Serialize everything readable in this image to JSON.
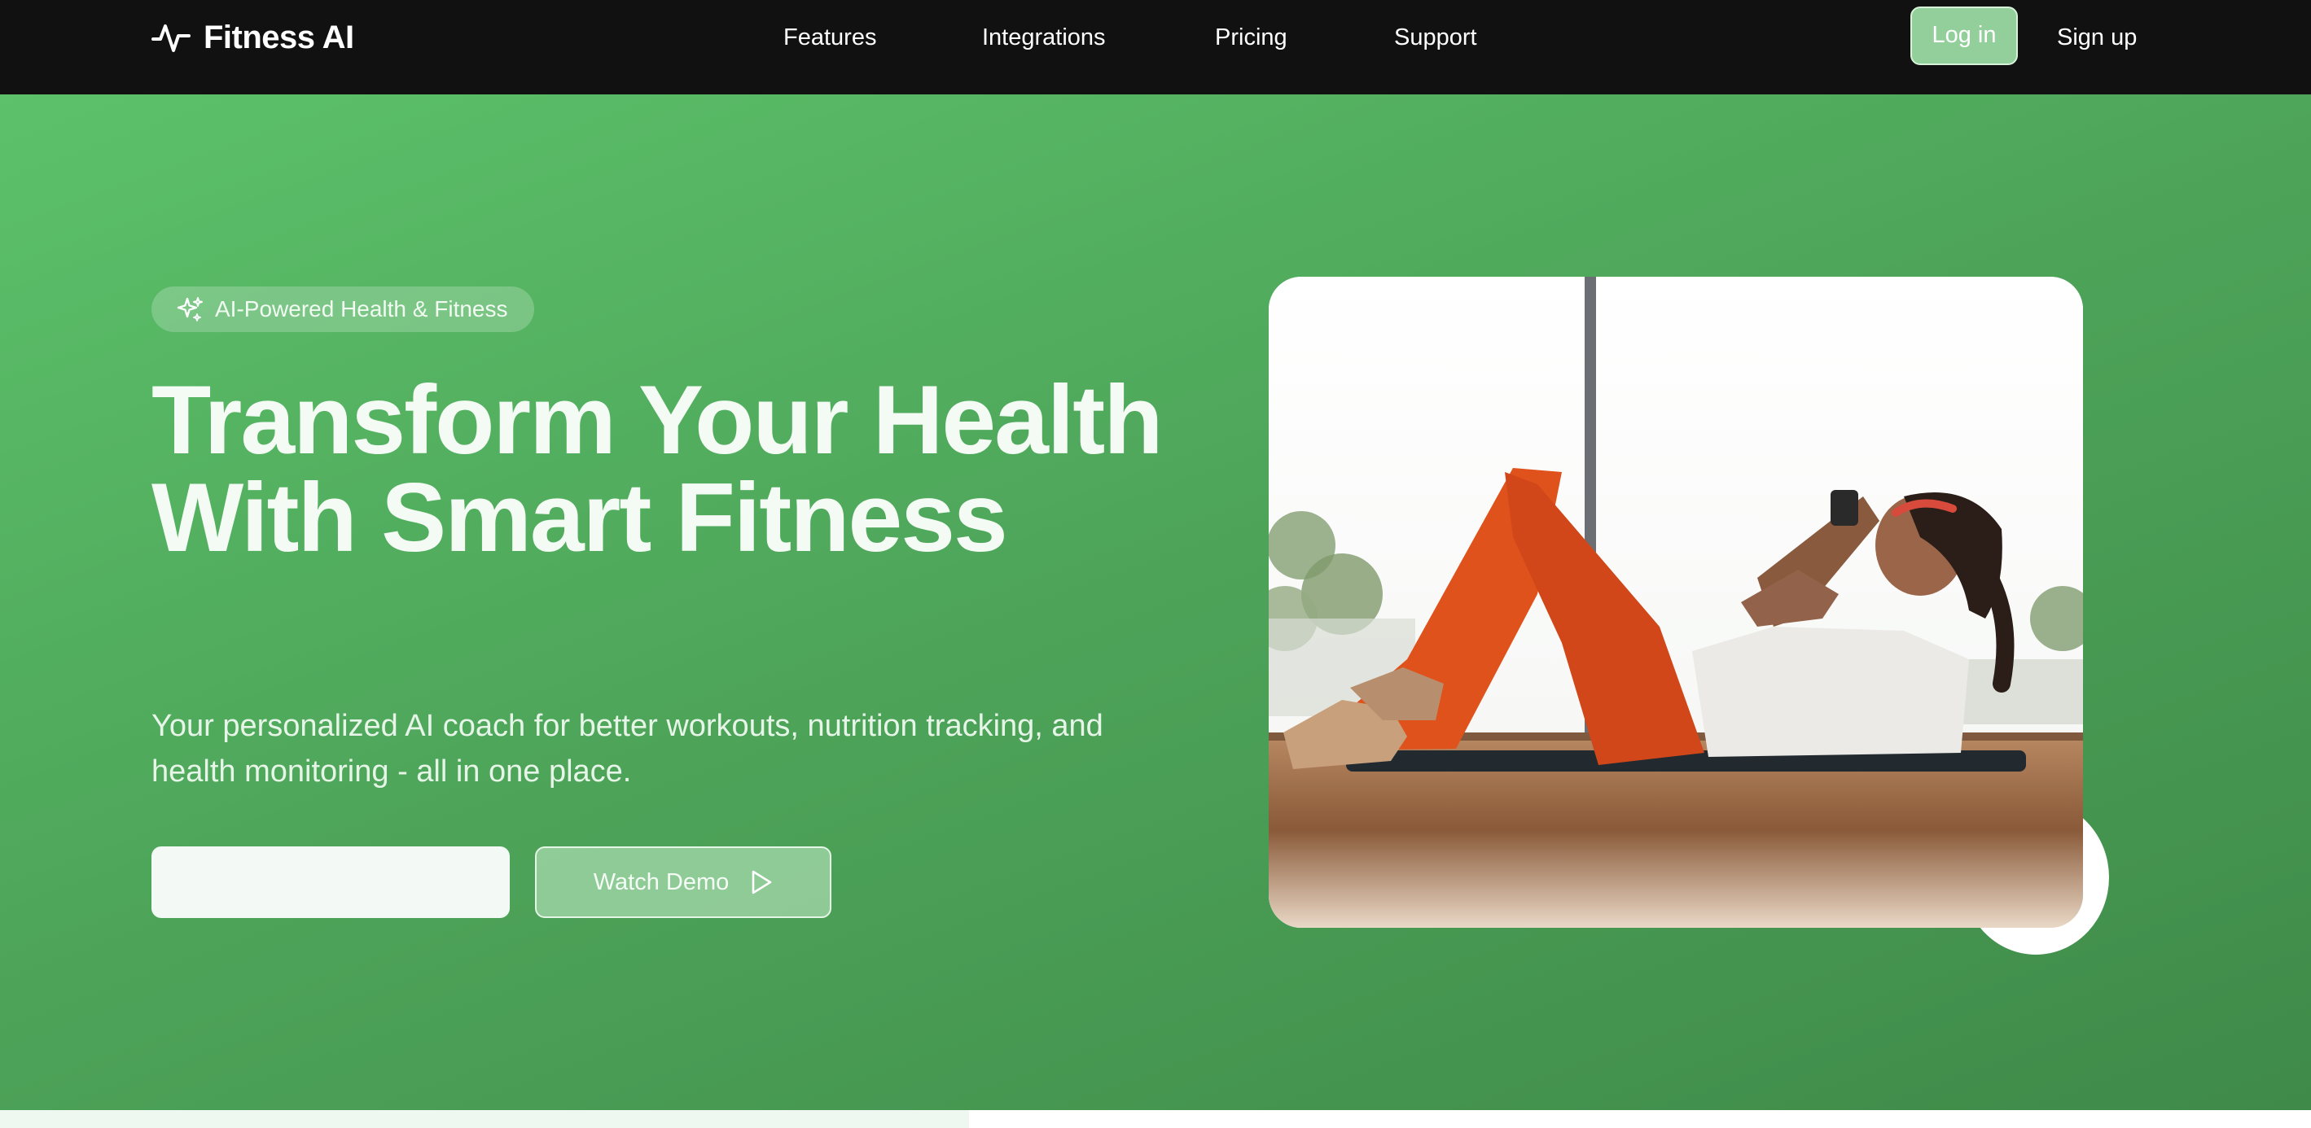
{
  "brand": {
    "name": "Fitness AI",
    "icon": "activity-pulse-icon"
  },
  "nav": {
    "links": [
      {
        "label": "Features"
      },
      {
        "label": "Integrations"
      },
      {
        "label": "Pricing"
      },
      {
        "label": "Support"
      }
    ],
    "login_label": "Log in",
    "signup_label": "Sign up"
  },
  "hero": {
    "badge": {
      "label": "AI-Powered Health & Fitness",
      "icon": "sparkles-icon"
    },
    "title": "Transform Your Health With Smart Fitness",
    "subtitle": "Your personalized AI coach for better workouts, nutrition tracking, and health monitoring - all in one place.",
    "cta_input": {
      "value": "",
      "placeholder": ""
    },
    "watch_demo": {
      "label": "Watch Demo",
      "icon": "play-icon"
    },
    "image": "woman-doing-crunches-photo"
  },
  "colors": {
    "nav_background": "#111111",
    "hero_gradient_start": "#5cc16a",
    "hero_gradient_end": "#3f8a49",
    "login_button": "#93cf9b"
  }
}
